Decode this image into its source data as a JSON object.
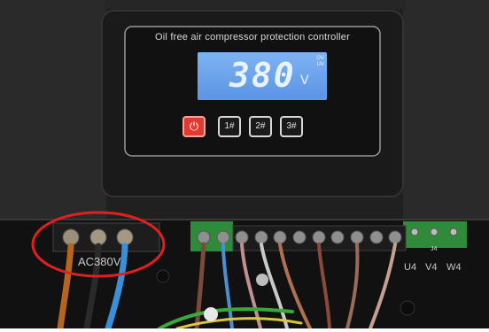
{
  "controller": {
    "title": "Oil free air compressor protection controller",
    "display_value": "380",
    "display_unit": "V",
    "flag_ov": "OV",
    "flag_uv": "UV"
  },
  "buttons": {
    "power_icon": "power-icon",
    "b1": "1#",
    "b2": "2#",
    "b3": "3#"
  },
  "terminal_labels": {
    "power_input": "AC380V",
    "j4": "J4",
    "outputs": [
      "U4",
      "V4",
      "W4"
    ]
  },
  "colors": {
    "lcd": "#6aa3ea",
    "power_button": "#e03b32",
    "highlight_circle": "#e02020",
    "terminal_block_green": "#2f8a3a"
  }
}
